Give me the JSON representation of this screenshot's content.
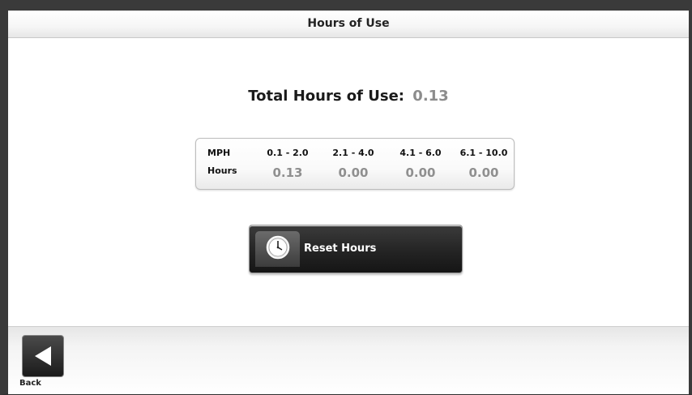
{
  "header": {
    "title": "Hours of Use"
  },
  "summary": {
    "label": "Total Hours of Use:",
    "value": "0.13"
  },
  "hours_table": {
    "header_label": "MPH",
    "row_label": "Hours",
    "columns": [
      "0.1 - 2.0",
      "2.1 - 4.0",
      "4.1 - 6.0",
      "6.1 - 10.0"
    ],
    "values": [
      "0.13",
      "0.00",
      "0.00",
      "0.00"
    ]
  },
  "actions": {
    "reset_label": "Reset Hours",
    "reset_icon": "clock-icon"
  },
  "footer": {
    "back_label": "Back",
    "back_icon": "back-arrow-icon"
  },
  "colors": {
    "value_gray": "#8f8f8f",
    "button_dark": "#242424"
  }
}
